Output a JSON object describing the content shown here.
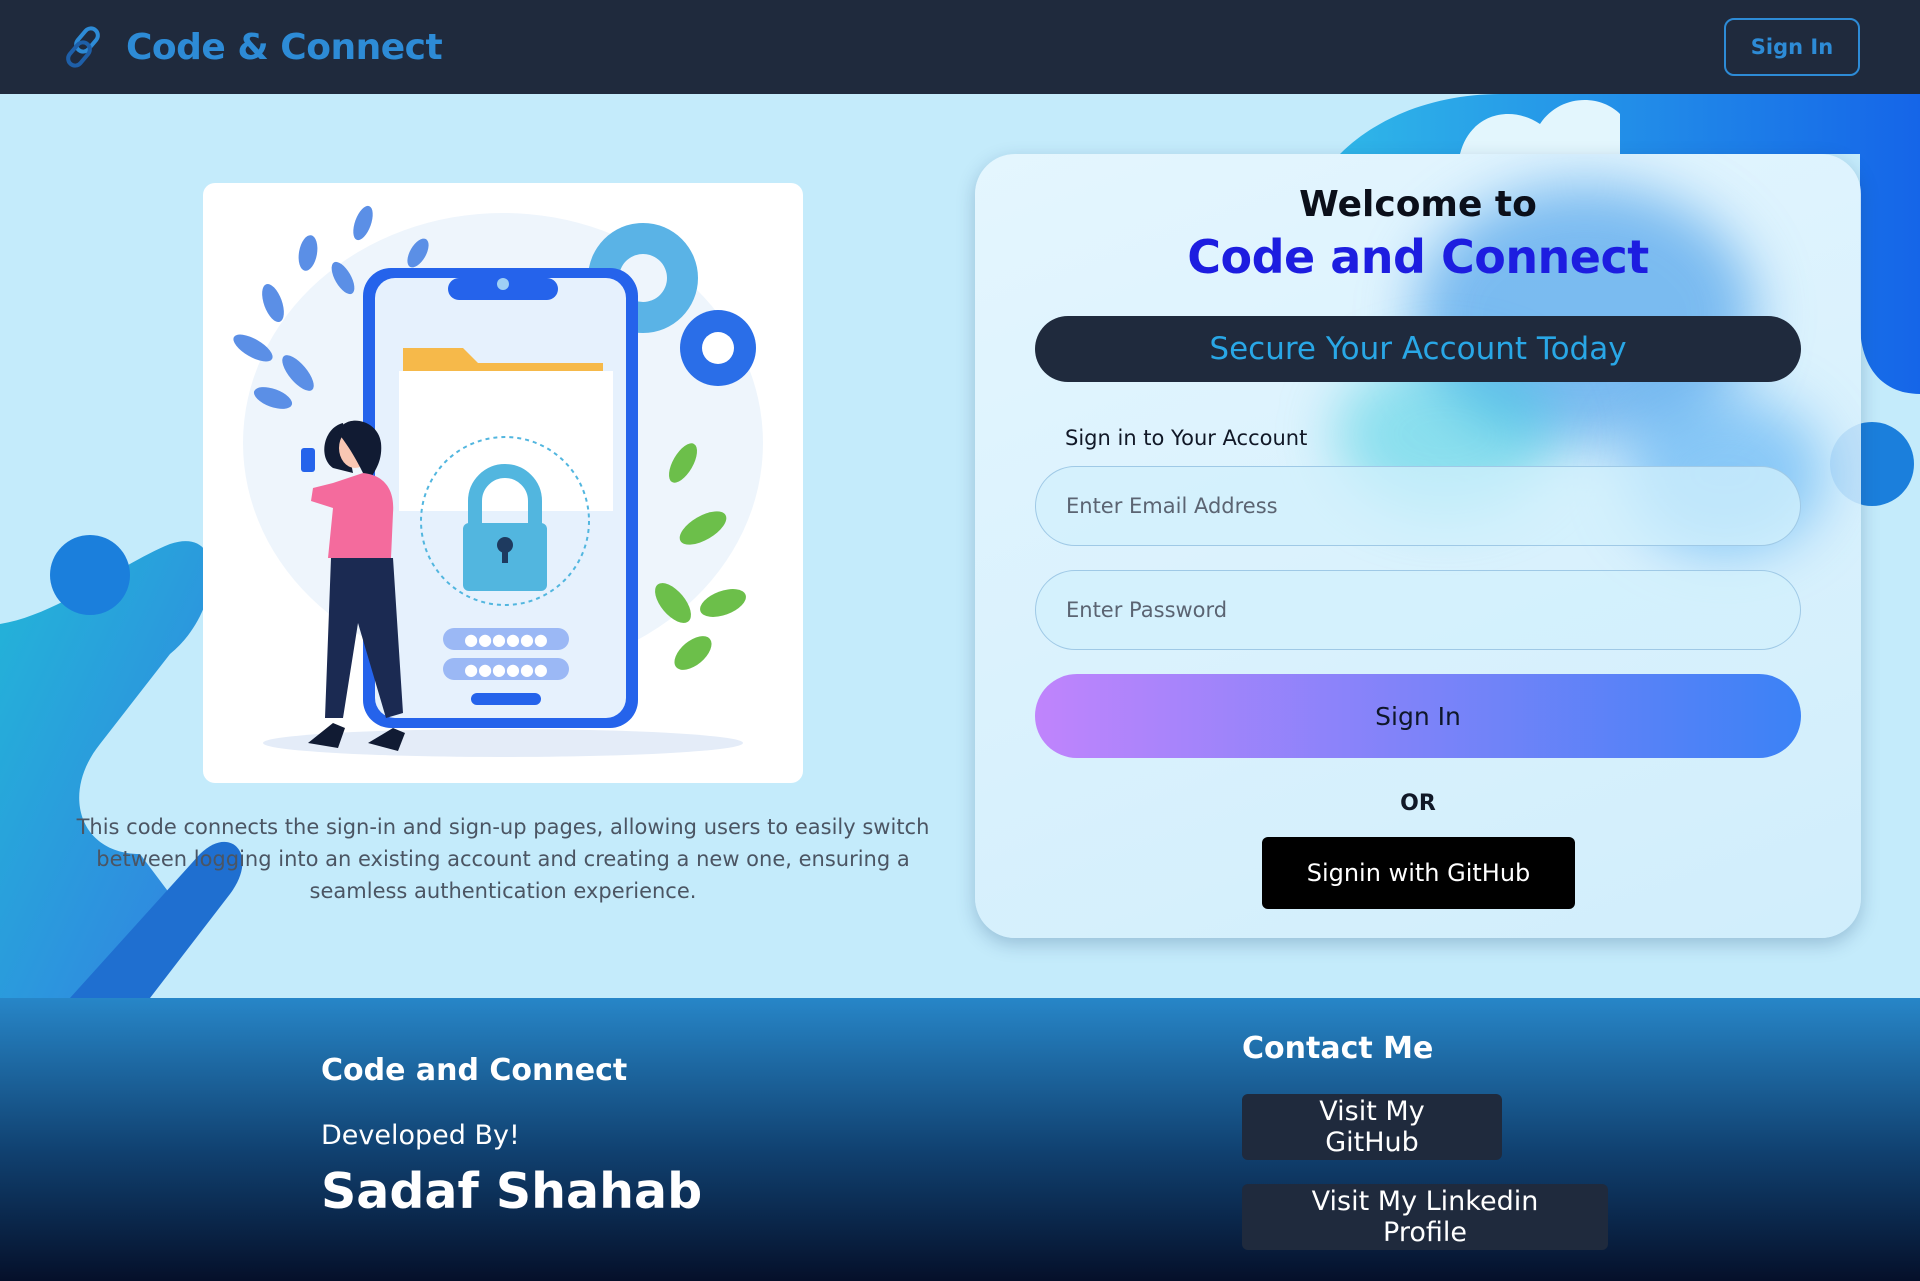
{
  "navbar": {
    "brand": "Code & Connect",
    "brand_icon": "link-chain-icon",
    "signin_label": "Sign In"
  },
  "hero": {
    "illustration": "phone-lock-security-illustration",
    "description": "This code connects the sign-in and sign-up pages, allowing users to easily switch between logging into an existing account and creating a new one, ensuring a seamless authentication experience."
  },
  "form": {
    "welcome_line1": "Welcome to",
    "welcome_line2": "Code and Connect",
    "banner": "Secure Your Account Today",
    "label": "Sign in to Your Account",
    "email_placeholder": "Enter Email Address",
    "password_placeholder": "Enter Password",
    "signin_label": "Sign In",
    "or_label": "OR",
    "github_label": "Signin with GitHub"
  },
  "footer": {
    "title": "Code and Connect",
    "developed_by": "Developed By!",
    "developer": "Sadaf Shahab",
    "contact_title": "Contact Me",
    "github_link": "Visit My GitHub",
    "linkedin_link": "Visit My Linkedin Profile"
  },
  "colors": {
    "nav_bg": "#1f2a3d",
    "brand_blue": "#2d8bd6",
    "heading_blue": "#1d1de0",
    "banner_text": "#29a7e6"
  }
}
